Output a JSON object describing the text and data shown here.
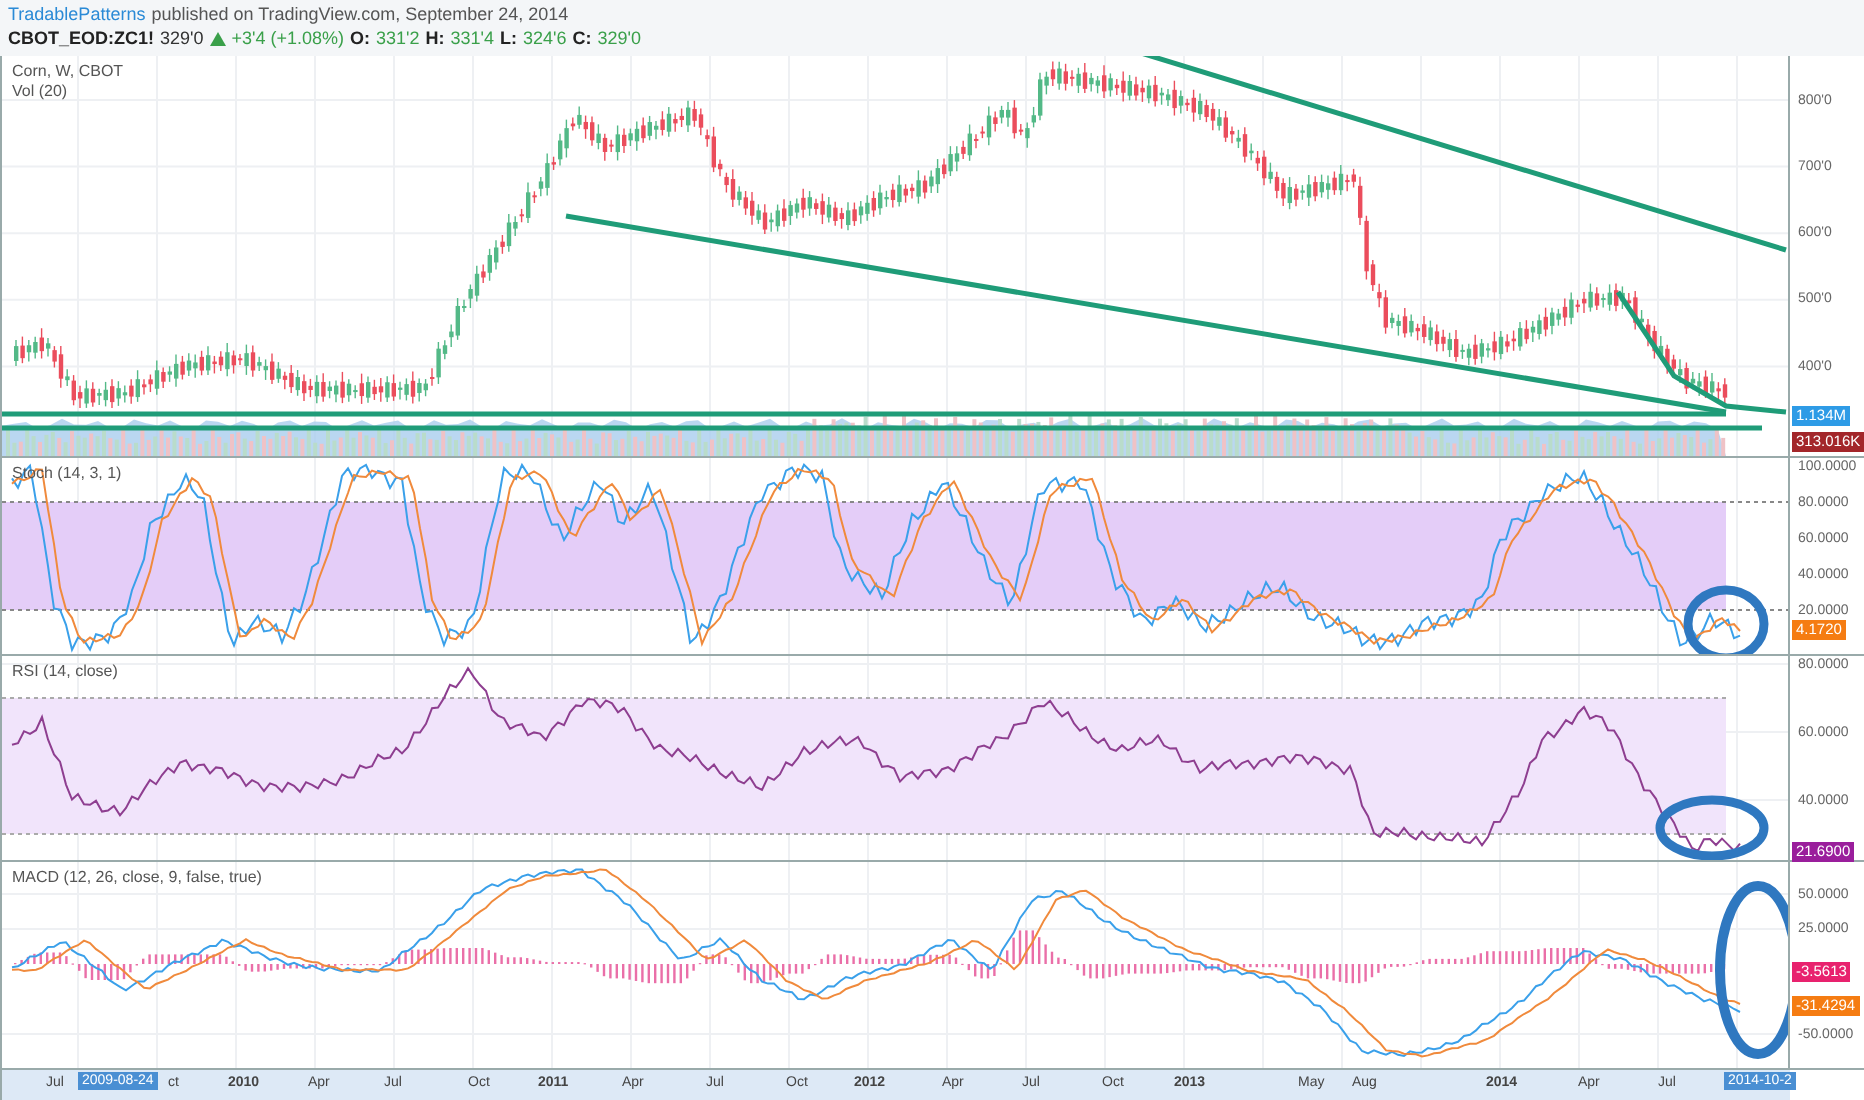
{
  "header": {
    "publisher": "TradablePatterns",
    "published_text": "published on TradingView.com, September 24, 2014"
  },
  "quote": {
    "symbol": "CBOT_EOD:ZC1!",
    "last": "329'0",
    "rising": true,
    "change": "+3'4 (+1.08%)",
    "ohlc": [
      {
        "label": "O:",
        "value": "331'2"
      },
      {
        "label": "H:",
        "value": "331'4"
      },
      {
        "label": "L:",
        "value": "324'6"
      },
      {
        "label": "C:",
        "value": "329'0"
      }
    ]
  },
  "panes": [
    {
      "kind": "price",
      "titles": [
        "Corn, W, CBOT",
        "Vol (20)"
      ],
      "ticks": [
        "800'0",
        "700'0",
        "600'0",
        "500'0",
        "400'0"
      ],
      "badges": [
        {
          "text": "1.134M",
          "color": "#2e9be6"
        },
        {
          "text": "313.016K",
          "color": "#a3262a"
        }
      ]
    },
    {
      "kind": "stoch",
      "titles": [
        "Stoch (14, 3, 1)"
      ],
      "ticks": [
        "100.0000",
        "80.0000",
        "60.0000",
        "40.0000",
        "20.0000"
      ],
      "badges": [
        {
          "text": "4.1720",
          "color": "#f57c12"
        }
      ]
    },
    {
      "kind": "rsi",
      "titles": [
        "RSI (14, close)"
      ],
      "ticks": [
        "80.0000",
        "60.0000",
        "40.0000"
      ],
      "badges": [
        {
          "text": "21.6900",
          "color": "#9a1e9c"
        }
      ]
    },
    {
      "kind": "macd",
      "titles": [
        "MACD (12, 26, close, 9, false, true)"
      ],
      "ticks": [
        "50.0000",
        "25.0000",
        "-50.0000"
      ],
      "badges": [
        {
          "text": "-3.5613",
          "color": "#e8226e"
        },
        {
          "text": "-31.4294",
          "color": "#f57c12"
        }
      ]
    }
  ],
  "time_axis": {
    "labels": [
      {
        "text": "Jul",
        "kind": "month"
      },
      {
        "text": "2009-08-24",
        "kind": "range"
      },
      {
        "text": "ct",
        "kind": "month"
      },
      {
        "text": "2010",
        "kind": "year"
      },
      {
        "text": "Apr",
        "kind": "month"
      },
      {
        "text": "Jul",
        "kind": "month"
      },
      {
        "text": "Oct",
        "kind": "month"
      },
      {
        "text": "2011",
        "kind": "year"
      },
      {
        "text": "Apr",
        "kind": "month"
      },
      {
        "text": "Jul",
        "kind": "month"
      },
      {
        "text": "Oct",
        "kind": "month"
      },
      {
        "text": "2012",
        "kind": "year"
      },
      {
        "text": "Apr",
        "kind": "month"
      },
      {
        "text": "Jul",
        "kind": "month"
      },
      {
        "text": "Oct",
        "kind": "month"
      },
      {
        "text": "2013",
        "kind": "year"
      },
      {
        "text": "May",
        "kind": "month"
      },
      {
        "text": "Aug",
        "kind": "month"
      },
      {
        "text": "2014",
        "kind": "year"
      },
      {
        "text": "Apr",
        "kind": "month"
      },
      {
        "text": "Jul",
        "kind": "month"
      },
      {
        "text": "2014-10-2",
        "kind": "range"
      }
    ]
  }
}
